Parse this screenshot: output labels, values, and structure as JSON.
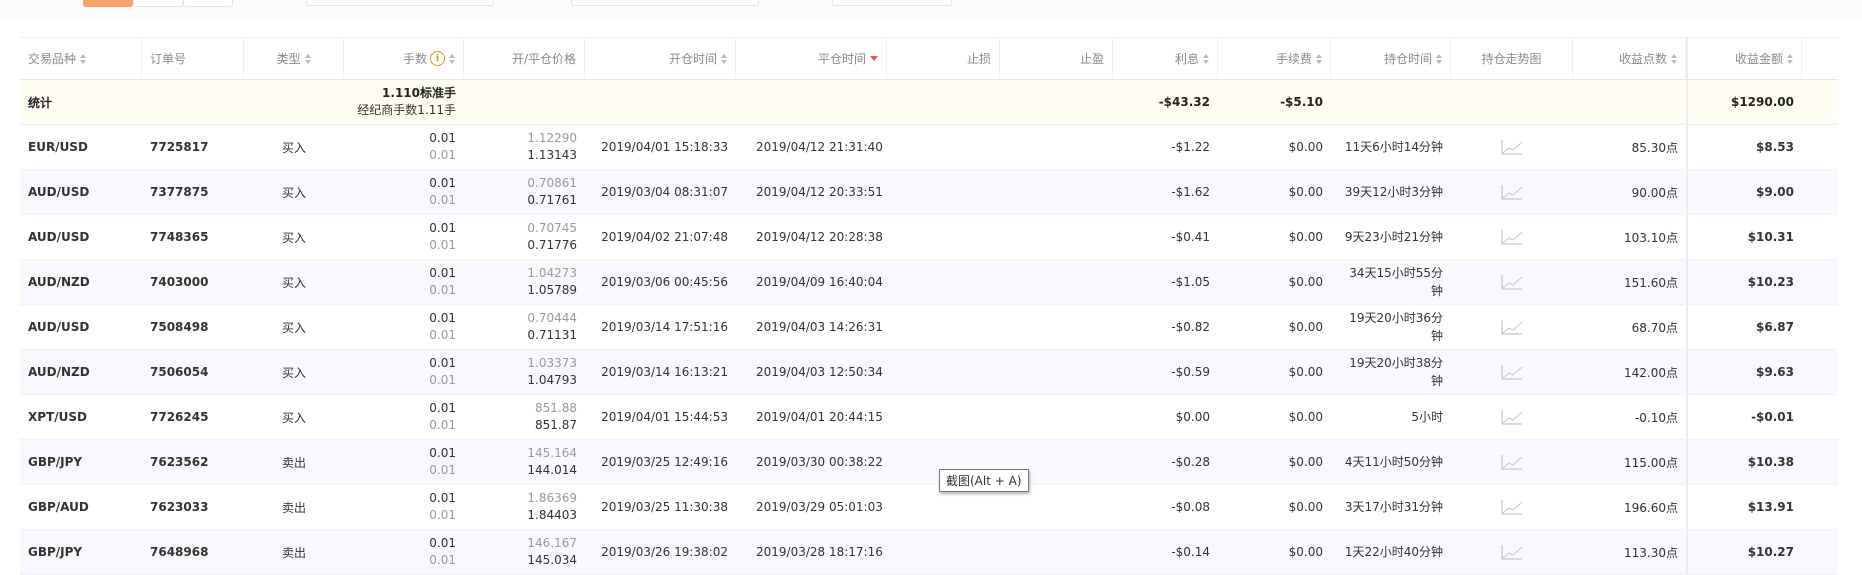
{
  "headers": {
    "symbol": "交易品种",
    "order": "订单号",
    "type": "类型",
    "lots": "手数",
    "price": "开/平仓价格",
    "open_time": "开仓时间",
    "close_time": "平仓时间",
    "sl": "止损",
    "tp": "止盈",
    "swap": "利息",
    "fee": "手续费",
    "hold": "持仓时间",
    "trend": "持仓走势图",
    "points": "收益点数",
    "amount": "收益金额"
  },
  "summary": {
    "label": "统计",
    "lots_std": "1.110标准手",
    "lots_broker": "经纪商手数1.11手",
    "swap": "-$43.32",
    "fee": "-$5.10",
    "amount": "$1290.00"
  },
  "rows": [
    {
      "symbol": "EUR/USD",
      "order": "7725817",
      "type": "买入",
      "lot1": "0.01",
      "lot2": "0.01",
      "open_price": "1.12290",
      "close_price": "1.13143",
      "open_time": "2019/04/01 15:18:33",
      "close_time": "2019/04/12 21:31:40",
      "swap": "-$1.22",
      "fee": "$0.00",
      "hold": "11天6小时14分钟",
      "points": "85.30点",
      "amount": "$8.53",
      "amount_color": "green"
    },
    {
      "symbol": "AUD/USD",
      "order": "7377875",
      "type": "买入",
      "lot1": "0.01",
      "lot2": "0.01",
      "open_price": "0.70861",
      "close_price": "0.71761",
      "open_time": "2019/03/04 08:31:07",
      "close_time": "2019/04/12 20:33:51",
      "swap": "-$1.62",
      "fee": "$0.00",
      "hold": "39天12小时3分钟",
      "points": "90.00点",
      "amount": "$9.00",
      "amount_color": "green"
    },
    {
      "symbol": "AUD/USD",
      "order": "7748365",
      "type": "买入",
      "lot1": "0.01",
      "lot2": "0.01",
      "open_price": "0.70745",
      "close_price": "0.71776",
      "open_time": "2019/04/02 21:07:48",
      "close_time": "2019/04/12 20:28:38",
      "swap": "-$0.41",
      "fee": "$0.00",
      "hold": "9天23小时21分钟",
      "points": "103.10点",
      "amount": "$10.31",
      "amount_color": "green"
    },
    {
      "symbol": "AUD/NZD",
      "order": "7403000",
      "type": "买入",
      "lot1": "0.01",
      "lot2": "0.01",
      "open_price": "1.04273",
      "close_price": "1.05789",
      "open_time": "2019/03/06 00:45:56",
      "close_time": "2019/04/09 16:40:04",
      "swap": "-$1.05",
      "fee": "$0.00",
      "hold": "34天15小时55分钟",
      "points": "151.60点",
      "amount": "$10.23",
      "amount_color": "green"
    },
    {
      "symbol": "AUD/USD",
      "order": "7508498",
      "type": "买入",
      "lot1": "0.01",
      "lot2": "0.01",
      "open_price": "0.70444",
      "close_price": "0.71131",
      "open_time": "2019/03/14 17:51:16",
      "close_time": "2019/04/03 14:26:31",
      "swap": "-$0.82",
      "fee": "$0.00",
      "hold": "19天20小时36分钟",
      "points": "68.70点",
      "amount": "$6.87",
      "amount_color": "green"
    },
    {
      "symbol": "AUD/NZD",
      "order": "7506054",
      "type": "买入",
      "lot1": "0.01",
      "lot2": "0.01",
      "open_price": "1.03373",
      "close_price": "1.04793",
      "open_time": "2019/03/14 16:13:21",
      "close_time": "2019/04/03 12:50:34",
      "swap": "-$0.59",
      "fee": "$0.00",
      "hold": "19天20小时38分钟",
      "points": "142.00点",
      "amount": "$9.63",
      "amount_color": "green"
    },
    {
      "symbol": "XPT/USD",
      "order": "7726245",
      "type": "买入",
      "lot1": "0.01",
      "lot2": "0.01",
      "open_price": "851.88",
      "close_price": "851.87",
      "open_time": "2019/04/01 15:44:53",
      "close_time": "2019/04/01 20:44:15",
      "swap": "$0.00",
      "fee": "$0.00",
      "hold": "5小时",
      "points": "-0.10点",
      "amount": "-$0.01",
      "amount_color": "neg"
    },
    {
      "symbol": "GBP/JPY",
      "order": "7623562",
      "type": "卖出",
      "lot1": "0.01",
      "lot2": "0.01",
      "open_price": "145.164",
      "close_price": "144.014",
      "open_time": "2019/03/25 12:49:16",
      "close_time": "2019/03/30 00:38:22",
      "swap": "-$0.28",
      "fee": "$0.00",
      "hold": "4天11小时50分钟",
      "points": "115.00点",
      "amount": "$10.38",
      "amount_color": "green"
    },
    {
      "symbol": "GBP/AUD",
      "order": "7623033",
      "type": "卖出",
      "lot1": "0.01",
      "lot2": "0.01",
      "open_price": "1.86369",
      "close_price": "1.84403",
      "open_time": "2019/03/25 11:30:38",
      "close_time": "2019/03/29 05:01:03",
      "swap": "-$0.08",
      "fee": "$0.00",
      "hold": "3天17小时31分钟",
      "points": "196.60点",
      "amount": "$13.91",
      "amount_color": "green"
    },
    {
      "symbol": "GBP/JPY",
      "order": "7648968",
      "type": "卖出",
      "lot1": "0.01",
      "lot2": "0.01",
      "open_price": "146.167",
      "close_price": "145.034",
      "open_time": "2019/03/26 19:38:02",
      "close_time": "2019/03/28 18:17:16",
      "swap": "-$0.14",
      "fee": "$0.00",
      "hold": "1天22小时40分钟",
      "points": "113.30点",
      "amount": "$10.27",
      "amount_color": "green"
    }
  ],
  "tooltip": "截图(Alt + A)",
  "colors": {
    "accent": "#f6a36a",
    "positive": "#17a461",
    "sort_active": "#e8544c",
    "info": "#e8912c"
  }
}
